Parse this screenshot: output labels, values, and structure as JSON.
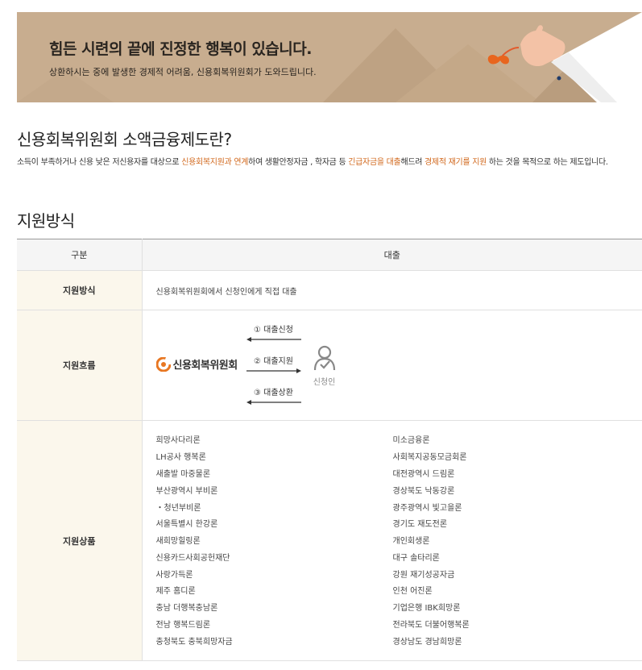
{
  "banner": {
    "title": "힘든 시련의 끝에 진정한 행복이 있습니다.",
    "subtitle": "상환하시는 중에 발생한 경제적 어려움, 신용회복위원회가 도와드립니다."
  },
  "intro_section": {
    "title": "신용회복위원회 소액금융제도란?",
    "text_1": "소득이 부족하거나 신용 낮은 저신용자를 대상으로 ",
    "hl_1": "신용회복지원과 연계",
    "text_2": "하여 생활안정자금 , 학자금 등 ",
    "hl_2": "긴급자금을 대출",
    "text_3": "해드려 ",
    "hl_3": "경제적 재기를 지원",
    "text_4": " 하는 것을 목적으로 하는 제도입니다."
  },
  "support_section": {
    "title": "지원방식",
    "table": {
      "header_col1": "구분",
      "header_col2": "대출",
      "row_method_label": "지원방식",
      "row_method_value": "신용회복위원회에서 신청인에게 직접 대출",
      "row_flow_label": "지원흐름",
      "row_products_label": "지원상품"
    },
    "flow": {
      "org_name": "신용회복위원회",
      "step1": "① 대출신청",
      "step2": "② 대출지원",
      "step3": "③ 대출상환",
      "applicant": "신청인"
    },
    "products_left": [
      "희망사다리론",
      "LH공사 행복론",
      "새출발 마중물론",
      "부산광역시 부비론",
      "・청년부비론",
      "서울특별시 한강론",
      "새희망힐링론",
      "신용카드사회공헌재단",
      "사랑가득론",
      "제주 홈디론",
      "충남 더행복충남론",
      "전남 행복드림론",
      "충청북도 충북희망자금"
    ],
    "products_right": [
      "미소금융론",
      "사회복지공동모금회론",
      "대전광역시 드림론",
      "경상북도 낙동강론",
      "광주광역시 빛고을론",
      "경기도 재도전론",
      "개인회생론",
      "대구 솔타리론",
      "강원 재기성공자금",
      "인천 어진론",
      "기업은행 IBK희망론",
      "전라북도 더불어행복론",
      "경상남도 경남희망론"
    ]
  },
  "colors": {
    "banner_bg": "#c8ad8f",
    "highlight": "#d2691e",
    "logo_orange": "#e87722",
    "label_bg": "#fbf7ec"
  }
}
